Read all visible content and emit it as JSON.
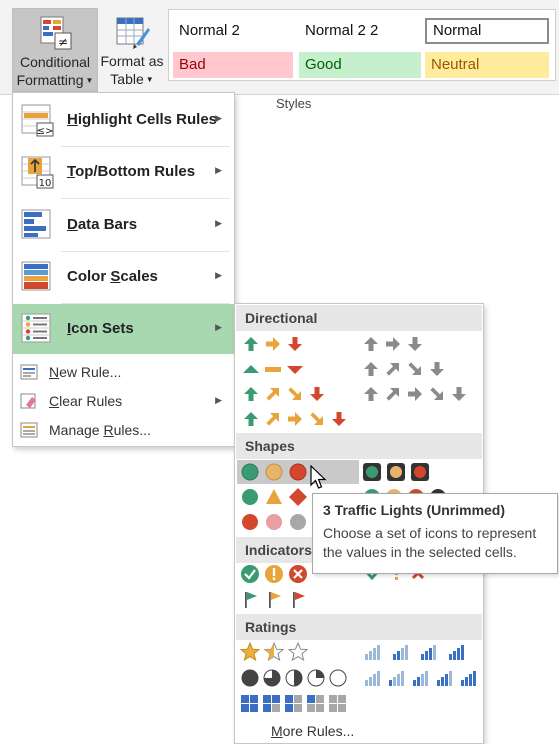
{
  "ribbon": {
    "conditional_formatting": {
      "line1": "Conditional",
      "line2": "Formatting"
    },
    "format_as_table": {
      "line1": "Format as",
      "line2": "Table"
    },
    "styles_group_label": "Styles",
    "styles": {
      "normal2": "Normal 2",
      "normal22": "Normal 2 2",
      "normal": "Normal",
      "bad": "Bad",
      "good": "Good",
      "neutral": "Neutral"
    }
  },
  "menu": {
    "highlight": {
      "label": "Highlight Cells Rules",
      "u": "H",
      "rest": "ighlight Cells Rules"
    },
    "topbottom": {
      "u": "T",
      "rest": "op/Bottom Rules"
    },
    "databars": {
      "u": "D",
      "rest": "ata Bars"
    },
    "colorscales": {
      "pre": "Color ",
      "u": "S",
      "rest": "cales"
    },
    "iconsets": {
      "u": "I",
      "rest": "con Sets"
    },
    "newrule": {
      "u": "N",
      "rest": "ew Rule..."
    },
    "clearrules": {
      "u": "C",
      "rest": "lear Rules"
    },
    "managerules": {
      "pre": "Manage ",
      "u": "R",
      "rest": "ules..."
    }
  },
  "submenu": {
    "sections": {
      "directional": "Directional",
      "shapes": "Shapes",
      "indicators": "Indicators",
      "ratings": "Ratings"
    },
    "more_rules": {
      "u": "M",
      "rest": "ore Rules..."
    }
  },
  "tooltip": {
    "title": "3 Traffic Lights (Unrimmed)",
    "body": "Choose a set of icons to represent the values in the selected cells."
  },
  "colors": {
    "green": "#3a9b72",
    "yellow": "#e8a33d",
    "red": "#d3472f",
    "gray": "#8a8a8a",
    "active_item": "#a8d8b0"
  },
  "icons": [
    "conditional-formatting-icon",
    "format-as-table-icon",
    "highlight-cells-icon",
    "top-bottom-icon",
    "data-bars-icon",
    "color-scales-icon",
    "icon-sets-icon",
    "arrow-icon",
    "circle-icon",
    "flag-icon",
    "star-icon",
    "signal-bars-icon",
    "quarters-icon",
    "pie-icon"
  ]
}
